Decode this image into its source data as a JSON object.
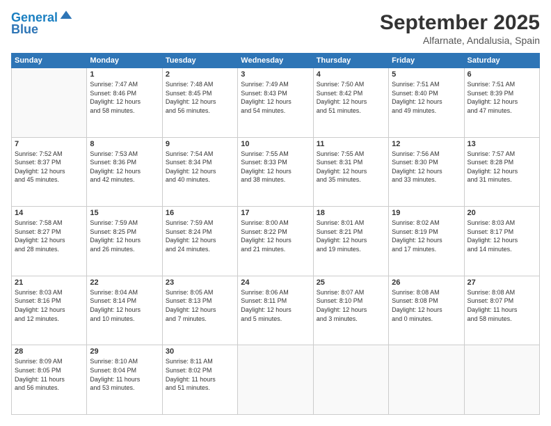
{
  "header": {
    "logo_line1": "General",
    "logo_line2": "Blue",
    "month_title": "September 2025",
    "location": "Alfarnate, Andalusia, Spain"
  },
  "weekdays": [
    "Sunday",
    "Monday",
    "Tuesday",
    "Wednesday",
    "Thursday",
    "Friday",
    "Saturday"
  ],
  "weeks": [
    [
      {
        "day": "",
        "info": ""
      },
      {
        "day": "1",
        "info": "Sunrise: 7:47 AM\nSunset: 8:46 PM\nDaylight: 12 hours\nand 58 minutes."
      },
      {
        "day": "2",
        "info": "Sunrise: 7:48 AM\nSunset: 8:45 PM\nDaylight: 12 hours\nand 56 minutes."
      },
      {
        "day": "3",
        "info": "Sunrise: 7:49 AM\nSunset: 8:43 PM\nDaylight: 12 hours\nand 54 minutes."
      },
      {
        "day": "4",
        "info": "Sunrise: 7:50 AM\nSunset: 8:42 PM\nDaylight: 12 hours\nand 51 minutes."
      },
      {
        "day": "5",
        "info": "Sunrise: 7:51 AM\nSunset: 8:40 PM\nDaylight: 12 hours\nand 49 minutes."
      },
      {
        "day": "6",
        "info": "Sunrise: 7:51 AM\nSunset: 8:39 PM\nDaylight: 12 hours\nand 47 minutes."
      }
    ],
    [
      {
        "day": "7",
        "info": "Sunrise: 7:52 AM\nSunset: 8:37 PM\nDaylight: 12 hours\nand 45 minutes."
      },
      {
        "day": "8",
        "info": "Sunrise: 7:53 AM\nSunset: 8:36 PM\nDaylight: 12 hours\nand 42 minutes."
      },
      {
        "day": "9",
        "info": "Sunrise: 7:54 AM\nSunset: 8:34 PM\nDaylight: 12 hours\nand 40 minutes."
      },
      {
        "day": "10",
        "info": "Sunrise: 7:55 AM\nSunset: 8:33 PM\nDaylight: 12 hours\nand 38 minutes."
      },
      {
        "day": "11",
        "info": "Sunrise: 7:55 AM\nSunset: 8:31 PM\nDaylight: 12 hours\nand 35 minutes."
      },
      {
        "day": "12",
        "info": "Sunrise: 7:56 AM\nSunset: 8:30 PM\nDaylight: 12 hours\nand 33 minutes."
      },
      {
        "day": "13",
        "info": "Sunrise: 7:57 AM\nSunset: 8:28 PM\nDaylight: 12 hours\nand 31 minutes."
      }
    ],
    [
      {
        "day": "14",
        "info": "Sunrise: 7:58 AM\nSunset: 8:27 PM\nDaylight: 12 hours\nand 28 minutes."
      },
      {
        "day": "15",
        "info": "Sunrise: 7:59 AM\nSunset: 8:25 PM\nDaylight: 12 hours\nand 26 minutes."
      },
      {
        "day": "16",
        "info": "Sunrise: 7:59 AM\nSunset: 8:24 PM\nDaylight: 12 hours\nand 24 minutes."
      },
      {
        "day": "17",
        "info": "Sunrise: 8:00 AM\nSunset: 8:22 PM\nDaylight: 12 hours\nand 21 minutes."
      },
      {
        "day": "18",
        "info": "Sunrise: 8:01 AM\nSunset: 8:21 PM\nDaylight: 12 hours\nand 19 minutes."
      },
      {
        "day": "19",
        "info": "Sunrise: 8:02 AM\nSunset: 8:19 PM\nDaylight: 12 hours\nand 17 minutes."
      },
      {
        "day": "20",
        "info": "Sunrise: 8:03 AM\nSunset: 8:17 PM\nDaylight: 12 hours\nand 14 minutes."
      }
    ],
    [
      {
        "day": "21",
        "info": "Sunrise: 8:03 AM\nSunset: 8:16 PM\nDaylight: 12 hours\nand 12 minutes."
      },
      {
        "day": "22",
        "info": "Sunrise: 8:04 AM\nSunset: 8:14 PM\nDaylight: 12 hours\nand 10 minutes."
      },
      {
        "day": "23",
        "info": "Sunrise: 8:05 AM\nSunset: 8:13 PM\nDaylight: 12 hours\nand 7 minutes."
      },
      {
        "day": "24",
        "info": "Sunrise: 8:06 AM\nSunset: 8:11 PM\nDaylight: 12 hours\nand 5 minutes."
      },
      {
        "day": "25",
        "info": "Sunrise: 8:07 AM\nSunset: 8:10 PM\nDaylight: 12 hours\nand 3 minutes."
      },
      {
        "day": "26",
        "info": "Sunrise: 8:08 AM\nSunset: 8:08 PM\nDaylight: 12 hours\nand 0 minutes."
      },
      {
        "day": "27",
        "info": "Sunrise: 8:08 AM\nSunset: 8:07 PM\nDaylight: 11 hours\nand 58 minutes."
      }
    ],
    [
      {
        "day": "28",
        "info": "Sunrise: 8:09 AM\nSunset: 8:05 PM\nDaylight: 11 hours\nand 56 minutes."
      },
      {
        "day": "29",
        "info": "Sunrise: 8:10 AM\nSunset: 8:04 PM\nDaylight: 11 hours\nand 53 minutes."
      },
      {
        "day": "30",
        "info": "Sunrise: 8:11 AM\nSunset: 8:02 PM\nDaylight: 11 hours\nand 51 minutes."
      },
      {
        "day": "",
        "info": ""
      },
      {
        "day": "",
        "info": ""
      },
      {
        "day": "",
        "info": ""
      },
      {
        "day": "",
        "info": ""
      }
    ]
  ]
}
